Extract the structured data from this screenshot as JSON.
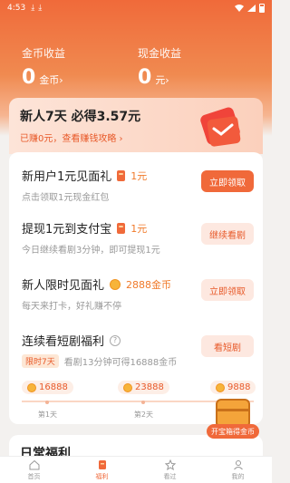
{
  "status": {
    "time": "4:53",
    "downloads": [
      "⤓",
      "⤓"
    ]
  },
  "earnings": {
    "gold": {
      "label": "金币收益",
      "value": "0",
      "unit": "金币›"
    },
    "cash": {
      "label": "现金收益",
      "value": "0",
      "unit": "元›"
    }
  },
  "newbie": {
    "title": "新人7天 必得3.57元",
    "subtitle": "已赚0元，查看赚钱攻略 ›"
  },
  "tasks": [
    {
      "title": "新用户1元见面礼",
      "reward": "1元",
      "desc": "点击领取1元现金红包",
      "button": "立即领取"
    },
    {
      "title": "提现1元到支付宝",
      "reward": "1元",
      "desc": "今日继续看剧3分钟，即可提现1元",
      "button": "继续看剧"
    },
    {
      "title": "新人限时见面礼",
      "reward": "2888金币",
      "desc": "每天来打卡，好礼赚不停",
      "button": "立即领取"
    }
  ],
  "streak": {
    "title": "连续看短剧福利",
    "help": "?",
    "badge": "限时7天",
    "desc": "看剧13分钟可得16888金币",
    "button": "看短剧",
    "progress": 0,
    "milestones": [
      {
        "coins": "16888",
        "day": "第1天"
      },
      {
        "coins": "23888",
        "day": "第2天"
      },
      {
        "coins": "9888",
        "day": ""
      }
    ]
  },
  "chest": {
    "label": "开宝箱得金币"
  },
  "daily": {
    "title": "日常福利"
  },
  "tabs": [
    {
      "label": "首页",
      "active": false
    },
    {
      "label": "福利",
      "active": true
    },
    {
      "label": "看过",
      "active": false
    },
    {
      "label": "我的",
      "active": false
    }
  ],
  "colors": {
    "accent": "#f0693a",
    "coin": "#f7b43a",
    "soft": "#fde8e0"
  }
}
